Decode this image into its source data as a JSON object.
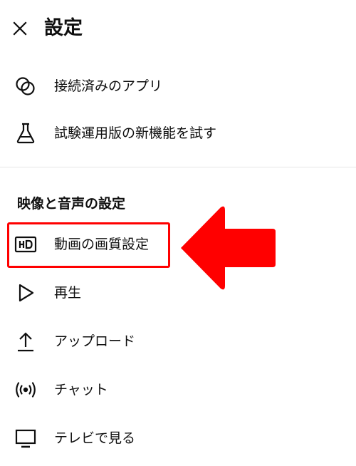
{
  "header": {
    "close_icon": "close-icon",
    "title": "設定"
  },
  "general": {
    "items": [
      {
        "icon": "connected-apps-icon",
        "label": "接続済みのアプリ"
      },
      {
        "icon": "beaker-icon",
        "label": "試験運用版の新機能を試す"
      }
    ]
  },
  "video_audio": {
    "section_title": "映像と音声の設定",
    "items": [
      {
        "icon": "hd-icon",
        "label": "動画の画質設定",
        "highlighted": true
      },
      {
        "icon": "play-icon",
        "label": "再生"
      },
      {
        "icon": "upload-icon",
        "label": "アップロード"
      },
      {
        "icon": "live-chat-icon",
        "label": "チャット"
      },
      {
        "icon": "tv-icon",
        "label": "テレビで見る"
      }
    ]
  },
  "annotation": {
    "highlight_color": "#ff0000",
    "arrow_color": "#ff0000"
  }
}
